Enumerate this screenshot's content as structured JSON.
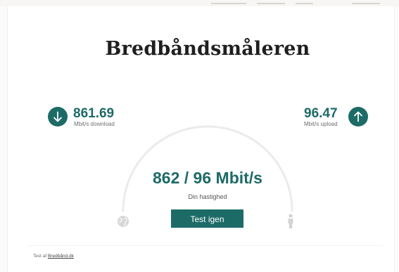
{
  "header": {
    "title": "Bredbåndsmåleren"
  },
  "download": {
    "value": "861.69",
    "label": "Mbit/s download",
    "icon": "arrow-down-icon"
  },
  "upload": {
    "value": "96.47",
    "label": "Mbit/s upload",
    "icon": "arrow-up-icon"
  },
  "result": {
    "speed": "862 / 96 Mbit/s",
    "label": "Din hastighed"
  },
  "actions": {
    "retest_label": "Test igen"
  },
  "footer": {
    "prefix": "Test af",
    "link_text": "Bredbånd.dk"
  },
  "colors": {
    "accent": "#1d6b67",
    "gauge_track": "#ebebeb",
    "title": "#1f1f1f"
  }
}
